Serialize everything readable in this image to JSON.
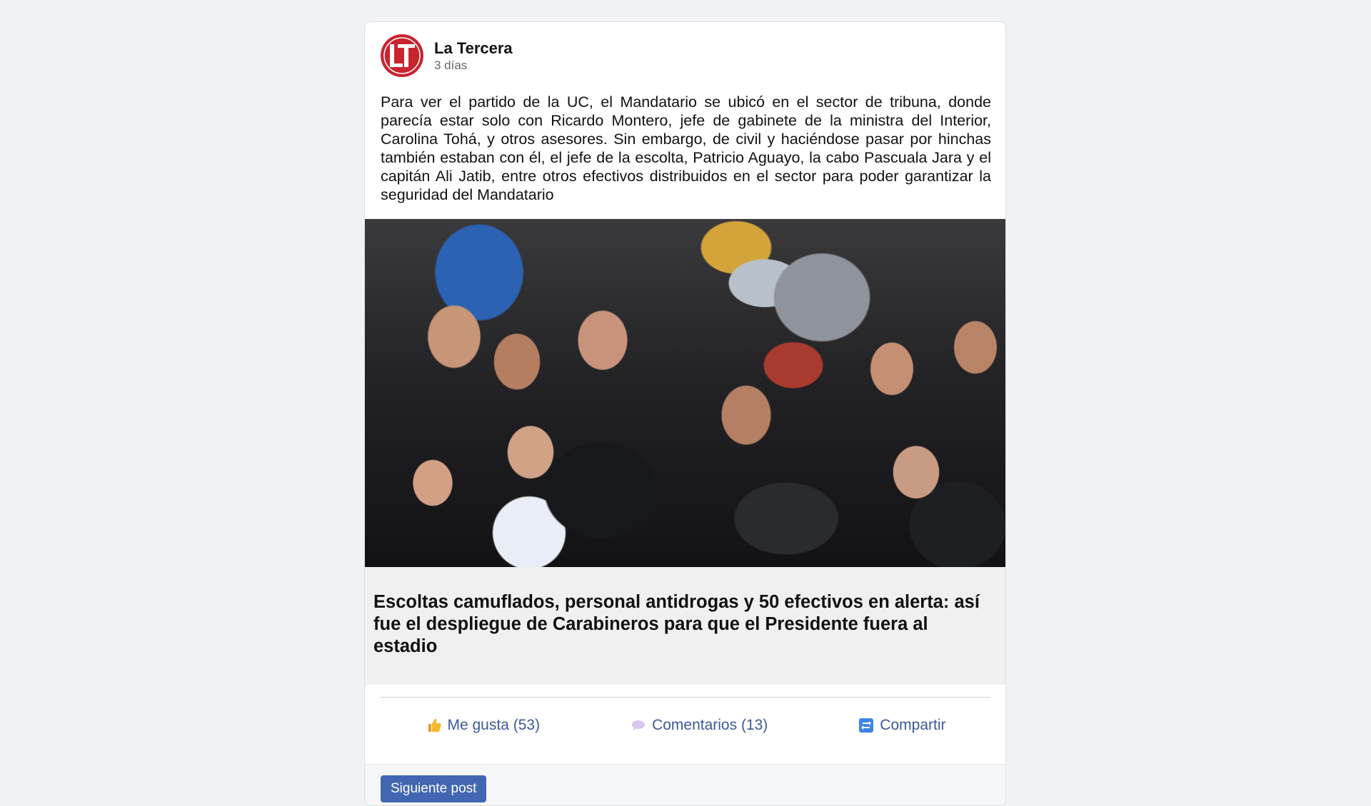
{
  "post": {
    "author": "La Tercera",
    "avatar_text": "LT",
    "time": "3 días",
    "text": "Para ver el partido de la UC, el Mandatario se ubicó en el sector de tribuna, donde parecía estar solo con Ricardo Montero, jefe de gabinete de la ministra del Interior, Carolina Tohá, y otros asesores. Sin embargo, de civil y haciéndose pasar por hinchas también estaban con él, el jefe de la escolta, Patricio Aguayo, la cabo Pascuala Jara y el capitán Ali Jatib, entre otros efectivos distribuidos en el sector para poder garantizar la seguridad del Mandatario",
    "link_title": "Escoltas camuflados, personal antidrogas y 50 efectivos en alerta: así fue el despliegue de Carabineros para que el Presidente fuera al estadio"
  },
  "actions": {
    "like": "Me gusta (53)",
    "comments": "Comentarios (13)",
    "share": "Compartir"
  },
  "navigation": {
    "next_post": "Siguiente post"
  },
  "icons": {
    "like": "thumbs-up-icon",
    "comments": "speech-bubble-icon",
    "share": "share-arrows-icon"
  },
  "colors": {
    "brand_red": "#c8242f",
    "link_blue": "#3b5998",
    "button_blue": "#4267b2"
  }
}
